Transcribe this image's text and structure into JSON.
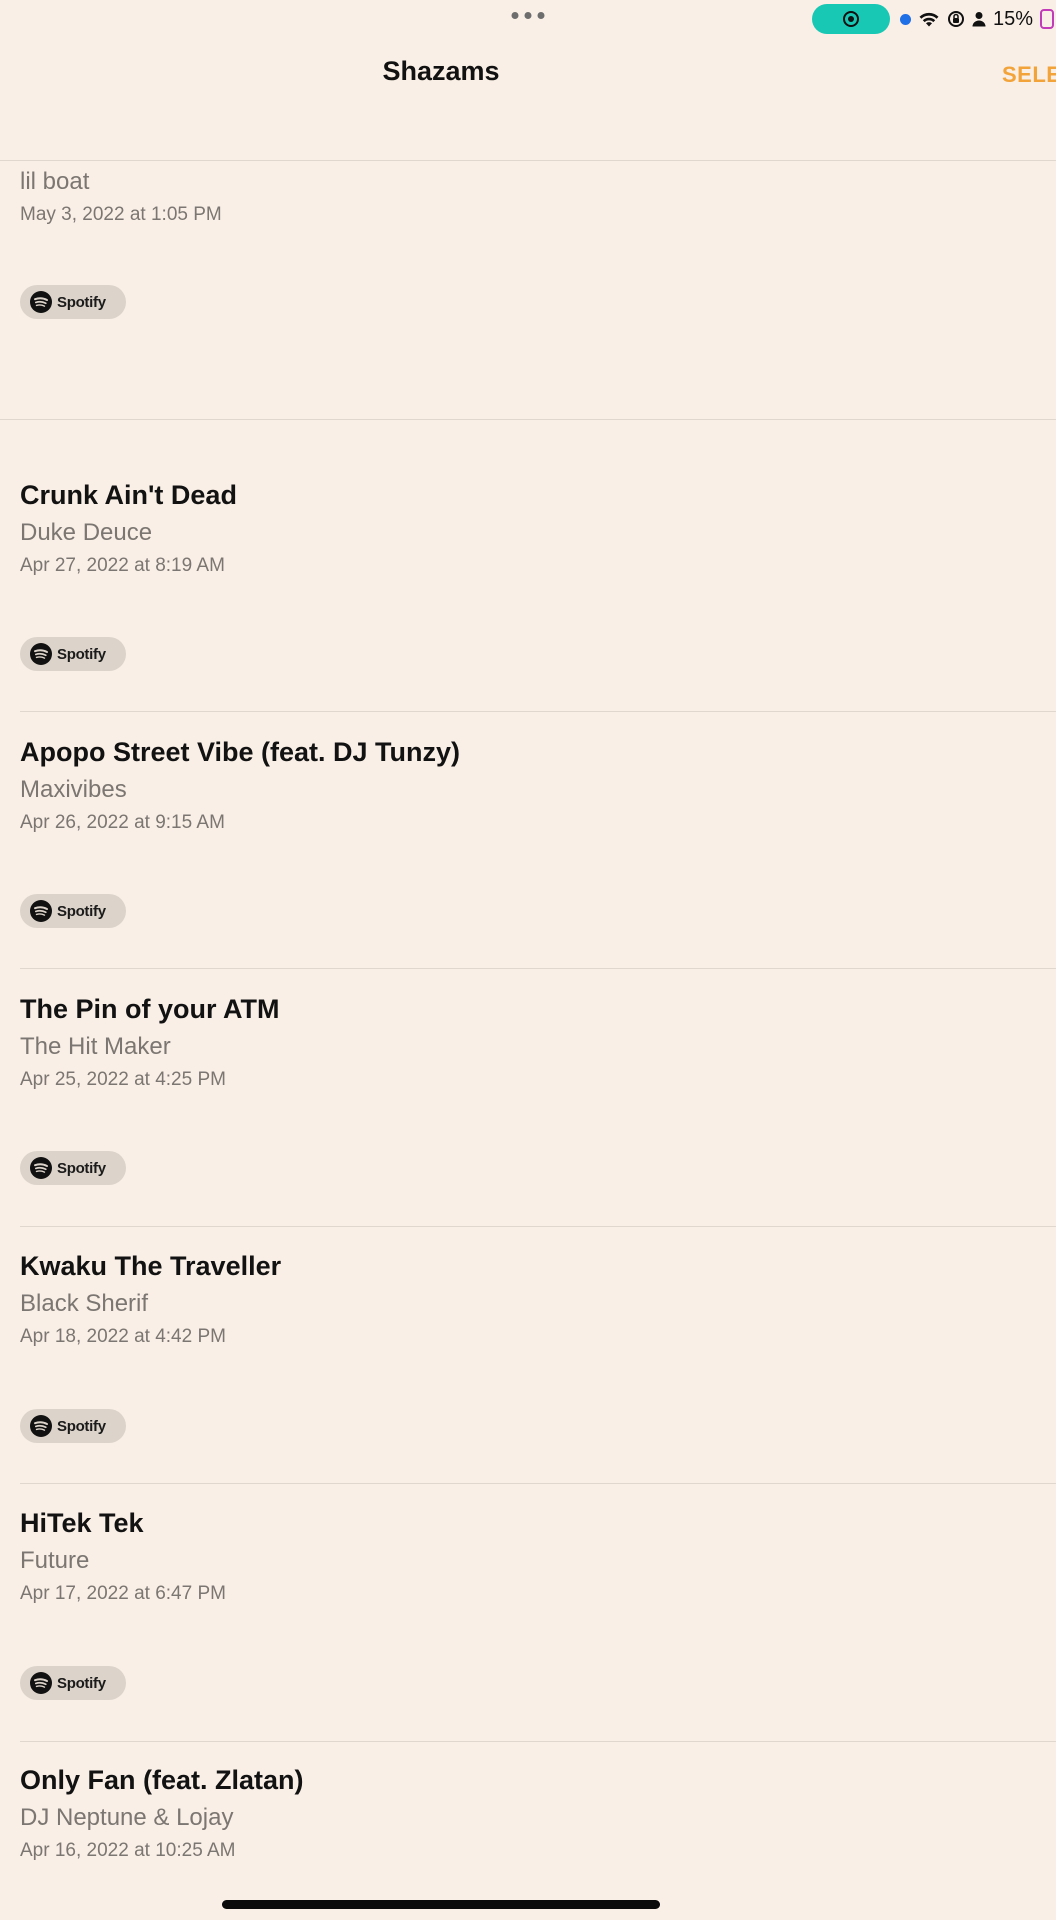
{
  "status_bar": {
    "battery_percent": "15%",
    "colors": {
      "record_pill": "#19c8b4",
      "location_dot": "#1f6fe6",
      "battery_outline": "#c23bb8"
    }
  },
  "nav": {
    "title": "Shazams",
    "select_label": "SELE"
  },
  "items": [
    {
      "title": "",
      "artist": "lil boat",
      "date": "May 3, 2022 at 1:05 PM",
      "action": "Spotify"
    },
    {
      "title": "Crunk Ain't Dead",
      "artist": "Duke Deuce",
      "date": "Apr 27, 2022 at 8:19 AM",
      "action": "Spotify"
    },
    {
      "title": "Apopo Street Vibe (feat. DJ Tunzy)",
      "artist": "Maxivibes",
      "date": "Apr 26, 2022 at 9:15 AM",
      "action": "Spotify"
    },
    {
      "title": "The Pin of your ATM",
      "artist": "The Hit Maker",
      "date": "Apr 25, 2022 at 4:25 PM",
      "action": "Spotify"
    },
    {
      "title": "Kwaku The Traveller",
      "artist": "Black Sherif",
      "date": "Apr 18, 2022 at 4:42 PM",
      "action": "Spotify"
    },
    {
      "title": "HiTek Tek",
      "artist": "Future",
      "date": "Apr 17, 2022 at 6:47 PM",
      "action": "Spotify"
    },
    {
      "title": "Only Fan (feat. Zlatan)",
      "artist": "DJ Neptune & Lojay",
      "date": "Apr 16, 2022 at 10:25 AM",
      "action": ""
    }
  ],
  "accent_color": "#f2a33a",
  "icons": [
    "record-icon",
    "location-dot-icon",
    "wifi-icon",
    "orientation-lock-icon",
    "person-icon",
    "battery-icon",
    "spotify-icon"
  ]
}
